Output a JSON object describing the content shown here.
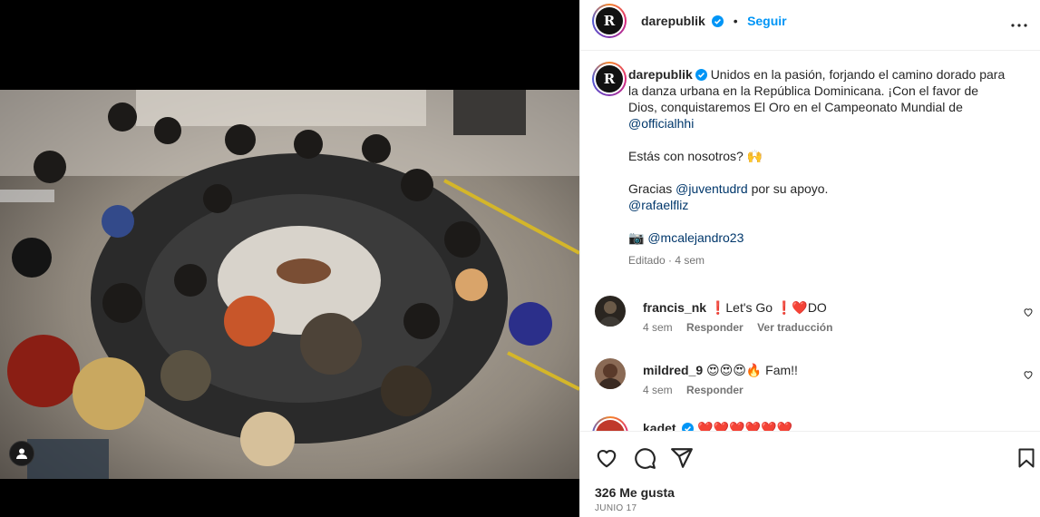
{
  "post": {
    "author": "darepublik",
    "follow_label": "Seguir",
    "separator": "•",
    "avatar_letter": "R"
  },
  "caption": {
    "line1": "Unidos en la pasión, forjando el camino dorado para la danza urbana en la República Dominicana. ¡Con el favor de Dios, conquistaremos El Oro en el Campeonato Mundial de ",
    "mention1": "@officialhhi",
    "line2": "Estás con nosotros? 🙌",
    "line3_prefix": "Gracias ",
    "mention2": "@juventudrd",
    "line3_suffix": " por su apoyo.",
    "mention3": "@rafaelfliz",
    "camera_emoji": "📷",
    "mention4": "@mcalejandro23",
    "meta": "Editado · 4 sem"
  },
  "comments": [
    {
      "user": "francis_nk",
      "text": "❗Let's Go ❗❤️DO",
      "time": "4 sem",
      "reply_label": "Responder",
      "translate_label": "Ver traducción"
    },
    {
      "user": "mildred_9",
      "text": "😍😍😍🔥 Fam!!",
      "time": "4 sem",
      "reply_label": "Responder"
    },
    {
      "user": "kadet",
      "text": "❤️❤️❤️❤️❤️❤️"
    }
  ],
  "footer": {
    "likes": "326 Me gusta",
    "date": "JUNIO 17"
  },
  "colors": {
    "accent": "#0095f6",
    "mention": "#00376b",
    "muted": "#737373"
  },
  "icons": {
    "more": "more-horizontal-icon",
    "like": "heart-icon",
    "comment": "comment-bubble-icon",
    "share": "paper-plane-icon",
    "save": "bookmark-icon",
    "tag": "user-tag-icon",
    "verified": "verified-badge-icon"
  }
}
